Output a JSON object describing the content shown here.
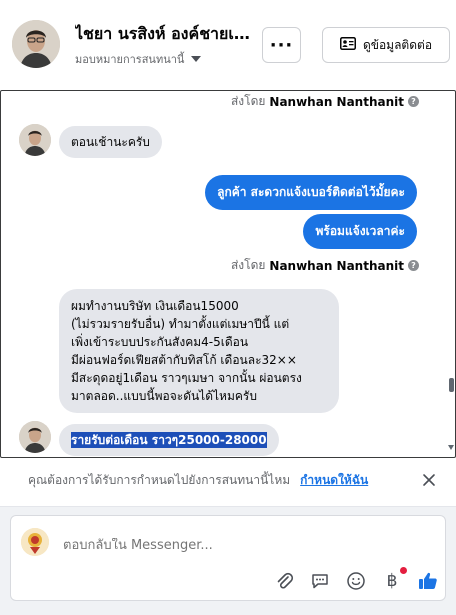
{
  "header": {
    "name": "ไชยา นรสิงห์ องค์ชายเจ้...",
    "assigned_to": "มอบหมายการสนทนานี้",
    "more_label": "···",
    "contact_button": "ดูข้อมูลติดต่อ"
  },
  "conversation": {
    "sent_by_1": {
      "prefix": "ส่งโดย",
      "agent": "Nanwhan Nanthanit"
    },
    "msg_in_1": "ตอนเช้านะครับ",
    "msg_out_1": "ลูกค้า สะดวกแจ้งเบอร์ติดต่อไว้มั้ยคะ",
    "msg_out_2": "พร้อมแจ้งเวลาค่ะ",
    "sent_by_2": {
      "prefix": "ส่งโดย",
      "agent": "Nanwhan Nanthanit"
    },
    "msg_in_2": "ผมทำงานบริษัท  เงินเดือน15000\n(ไม่รวมรายรับอื่น)  ทำมาตั้งแต่เมษาปีนี้  แต่\nเพิ่งเข้าระบบประกันสังคม4-5เดือน\nมีผ่อนฟอร์ดเฟียสต้ากับทิสโก้ เดือนละ32××\nมีสะดุดอยู่1เดือน ราวๆเมษา  จากนั้น ผ่อนตรง\nมาตลอด..แบบนี้พอจะดันได้ไหมครับ",
    "msg_in_3": "รายรับต่อเดือน  ราวๆ25000-28000"
  },
  "reminder": {
    "text": "คุณต้องการได้รับการกำหนดไปยังการสนทนานี้ไหม",
    "link": "กำหนดให้ฉัน"
  },
  "composer": {
    "placeholder": "ตอบกลับใน Messenger...",
    "baht_symbol": "฿"
  },
  "colors": {
    "accent": "#1b74e4",
    "incoming_bubble": "#e4e6eb",
    "selection": "#1d4fb8",
    "notification_dot": "#e41e3f"
  },
  "icons": [
    "avatar",
    "more-icon",
    "contact-card-icon",
    "caret-down-icon",
    "help-icon",
    "close-icon",
    "paperclip-icon",
    "chat-bubble-icon",
    "emoji-icon",
    "baht-icon",
    "thumbs-up-icon"
  ]
}
